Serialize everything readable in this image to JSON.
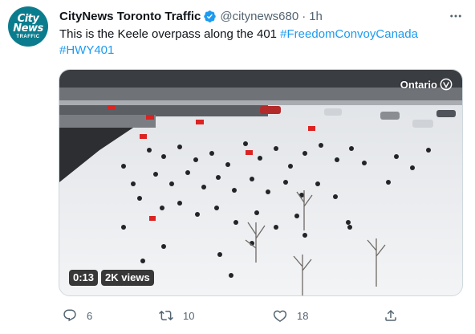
{
  "tweet": {
    "avatar": {
      "line1": "City",
      "line2": "News",
      "line3": "TRAFFIC",
      "color": "#0b7c8d"
    },
    "display_name": "CityNews Toronto Traffic",
    "handle": "@citynews680",
    "separator": "·",
    "time": "1h",
    "more_icon": "more-icon",
    "text": "This is the Keele overpass along the 401 ",
    "hashtags": [
      "#FreedomConvoyCanada",
      "#HWY401"
    ],
    "link_color": "#1d9bf0"
  },
  "media": {
    "watermark": "Ontario",
    "duration": "0:13",
    "views": "2K views"
  },
  "actions": {
    "reply_count": "6",
    "retweet_count": "10",
    "like_count": "18"
  }
}
